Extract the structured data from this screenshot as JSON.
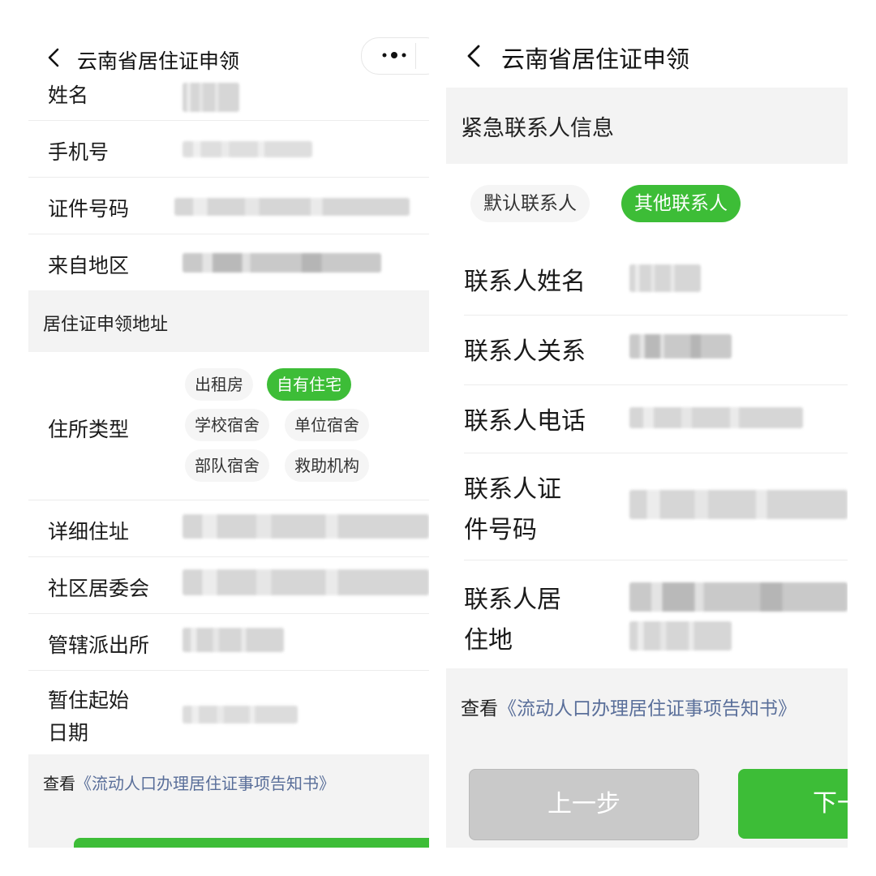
{
  "left": {
    "title": "云南省居住证申领",
    "rows": [
      {
        "label": "姓名"
      },
      {
        "label": "手机号"
      },
      {
        "label": "证件号码"
      },
      {
        "label": "来自地区"
      }
    ],
    "address_section": "居住证申领地址",
    "residence_type": {
      "label": "住所类型",
      "options": [
        "出租房",
        "自有住宅",
        "学校宿舍",
        "单位宿舍",
        "部队宿舍",
        "救助机构"
      ],
      "selected": "自有住宅"
    },
    "rows2": [
      {
        "label": "详细住址"
      },
      {
        "label": "社区居委会"
      },
      {
        "label": "管辖派出所"
      }
    ],
    "start_date": {
      "line1": "暂住起始",
      "line2": "日期"
    },
    "notice": {
      "prefix": "查看",
      "link": "《流动人口办理居住证事项告知书》"
    }
  },
  "right": {
    "title": "云南省居住证申领",
    "section": "紧急联系人信息",
    "tabs": [
      "默认联系人",
      "其他联系人"
    ],
    "selected_tab": "其他联系人",
    "rows": [
      {
        "label": "联系人姓名"
      },
      {
        "label": "联系人关系"
      },
      {
        "label": "联系人电话"
      }
    ],
    "id_row": {
      "line1": "联系人证",
      "line2": "件号码"
    },
    "addr_row": {
      "line1": "联系人居",
      "line2": "住地"
    },
    "notice": {
      "prefix": "查看",
      "link": "《流动人口办理居住证事项告知书》"
    },
    "buttons": {
      "prev": "上一步",
      "next": "下一步"
    }
  },
  "colors": {
    "accent": "#3dbd37",
    "link": "#5a6f9a",
    "section_bg": "#f3f3f3",
    "disabled_btn": "#c9c9c9"
  }
}
